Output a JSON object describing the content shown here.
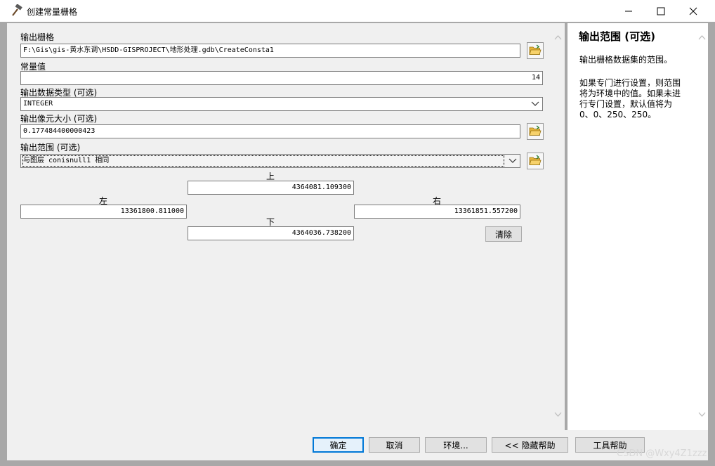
{
  "window": {
    "title": "创建常量栅格",
    "controls": [
      "minimize-icon",
      "maximize-icon",
      "close-icon"
    ]
  },
  "params": {
    "output_raster": {
      "label": "输出栅格",
      "value": "F:\\Gis\\gis-黄水东调\\HSDD-GISPROJECT\\地形处理.gdb\\CreateConsta1"
    },
    "constant": {
      "label": "常量值",
      "value": "14"
    },
    "data_type": {
      "label": "输出数据类型 (可选)",
      "value": "INTEGER"
    },
    "cell_size": {
      "label": "输出像元大小 (可选)",
      "value": "0.177484400000423"
    },
    "extent": {
      "label": "输出范围 (可选)",
      "value": "与图层 conisnull1 相同",
      "top_label": "上",
      "top_value": "4364081.109300",
      "left_label": "左",
      "left_value": "13361800.811000",
      "right_label": "右",
      "right_value": "13361851.557200",
      "bottom_label": "下",
      "bottom_value": "4364036.738200",
      "clear_label": "清除"
    }
  },
  "help": {
    "title": "输出范围 (可选)",
    "para1": "输出栅格数据集的范围。",
    "para2_lines": [
      "如果专门进行设置，则范围",
      "将为环境中的值。如果未进",
      "行专门设置，默认值将为",
      "0、0、250、250。"
    ]
  },
  "buttons": {
    "ok": "确定",
    "cancel": "取消",
    "env": "环境...",
    "hide_help": "<< 隐藏帮助",
    "tool_help": "工具帮助"
  },
  "watermark": "CSDN @Wxy4Z1zzz",
  "colors": {
    "accent": "#0078d7",
    "panel": "#f0f0f0",
    "frame": "#a8a8a8"
  }
}
